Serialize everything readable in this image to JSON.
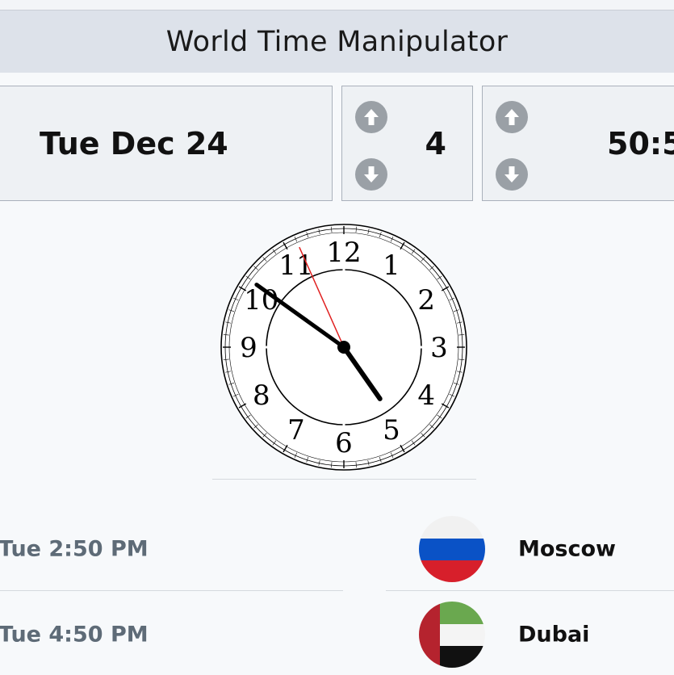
{
  "app": {
    "title": "World Time Manipulator"
  },
  "controls": {
    "date": "Tue Dec 24",
    "hour": "4",
    "minute": "50:5",
    "hour_up_icon": "arrow-up-circle",
    "hour_down_icon": "arrow-down-circle",
    "minute_up_icon": "arrow-up-circle",
    "minute_down_icon": "arrow-down-circle"
  },
  "clock": {
    "numerals": [
      "12",
      "1",
      "2",
      "3",
      "4",
      "5",
      "6",
      "7",
      "8",
      "9",
      "10",
      "11"
    ],
    "hour": 4,
    "minute": 50,
    "second": 56,
    "second_hand_color": "#e02020"
  },
  "cities": [
    {
      "time": "Tue 2:50 PM",
      "city": "Moscow",
      "flag": "russia-flag"
    },
    {
      "time": "Tue 4:50 PM",
      "city": "Dubai",
      "flag": "uae-flag"
    }
  ],
  "colors": {
    "title_bar": "#dde2ea",
    "button_gray": "#9aa0a6",
    "time_text": "#5e6b77"
  }
}
